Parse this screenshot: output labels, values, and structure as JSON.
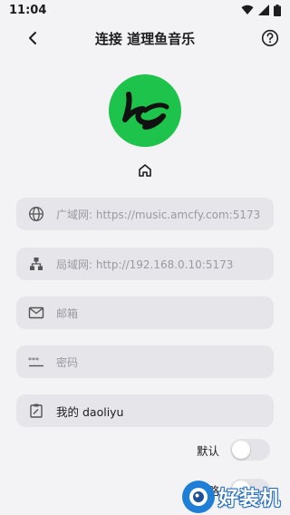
{
  "status": {
    "time": "11:04"
  },
  "header": {
    "title": "连接 道理鱼音乐"
  },
  "fields": [
    {
      "icon": "globe-icon",
      "placeholder": "广域网: https://music.amcfy.com:5173",
      "value": ""
    },
    {
      "icon": "lan-icon",
      "placeholder": "局域网: http://192.168.0.10:5173",
      "value": ""
    },
    {
      "icon": "mail-icon",
      "placeholder": "邮箱",
      "value": ""
    },
    {
      "icon": "password-icon",
      "placeholder": "密码",
      "value": ""
    },
    {
      "icon": "clipboard-icon",
      "placeholder": "",
      "value": "我的 daoliyu"
    }
  ],
  "toggles": [
    {
      "label": "默认",
      "on": false
    },
    {
      "label": "忽略",
      "on": false
    }
  ],
  "colors": {
    "brand": "#1ec34b",
    "field_bg": "#e5e5ea",
    "background": "#f3f3f6"
  },
  "watermark": {
    "text": "好装机"
  }
}
